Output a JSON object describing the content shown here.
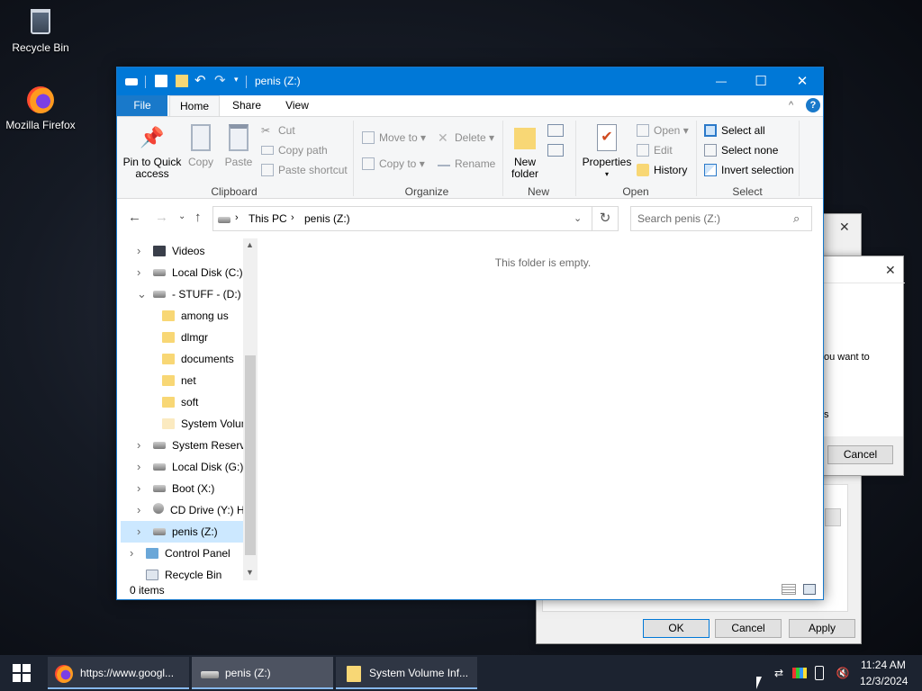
{
  "desktop": {
    "recycle_bin": "Recycle Bin",
    "firefox": "Mozilla Firefox"
  },
  "bg_dialogs": {
    "partial_text_1": "ou want to",
    "partial_text_2": "s",
    "cancel_inner": "Cancel",
    "ok": "OK",
    "cancel": "Cancel",
    "apply": "Apply",
    "close": "✕"
  },
  "window": {
    "title": "penis (Z:)",
    "minimize": "—",
    "maximize": "☐",
    "close": "✕",
    "tabs": {
      "file": "File",
      "home": "Home",
      "share": "Share",
      "view": "View"
    },
    "help": "?",
    "collapse": "^",
    "ribbon": {
      "clipboard": {
        "label": "Clipboard",
        "pin": "Pin to Quick access",
        "copy": "Copy",
        "paste": "Paste",
        "cut": "Cut",
        "copy_path": "Copy path",
        "paste_shortcut": "Paste shortcut"
      },
      "organize": {
        "label": "Organize",
        "move_to": "Move to",
        "copy_to": "Copy to",
        "delete": "Delete",
        "rename": "Rename"
      },
      "new": {
        "label": "New",
        "new_folder": "New folder"
      },
      "open": {
        "label": "Open",
        "properties": "Properties",
        "open": "Open",
        "edit": "Edit",
        "history": "History"
      },
      "select": {
        "label": "Select",
        "select_all": "Select all",
        "select_none": "Select none",
        "invert": "Invert selection"
      }
    },
    "address": {
      "crumbs": [
        "This PC",
        "penis (Z:)"
      ],
      "search_placeholder": "Search penis (Z:)"
    },
    "nav": [
      {
        "label": "Videos",
        "type": "videos"
      },
      {
        "label": "Local Disk (C:)",
        "type": "drive"
      },
      {
        "label": "- STUFF - (D:)",
        "type": "drive"
      },
      {
        "label": "among us",
        "type": "folder"
      },
      {
        "label": "dlmgr",
        "type": "folder"
      },
      {
        "label": "documents",
        "type": "folder"
      },
      {
        "label": "net",
        "type": "folder"
      },
      {
        "label": "soft",
        "type": "folder"
      },
      {
        "label": "System Volume Information",
        "type": "sysfolder"
      },
      {
        "label": "System Reserved",
        "type": "drive"
      },
      {
        "label": "Local Disk (G:)",
        "type": "drive"
      },
      {
        "label": "Boot (X:)",
        "type": "drive"
      },
      {
        "label": "CD Drive (Y:) H",
        "type": "cd"
      },
      {
        "label": "penis (Z:)",
        "type": "drive"
      },
      {
        "label": "Control Panel",
        "type": "cpanel"
      },
      {
        "label": "Recycle Bin",
        "type": "recycle"
      }
    ],
    "empty_message": "This folder is empty.",
    "status": "0 items"
  },
  "taskbar": {
    "items": [
      "https://www.googl...",
      "penis (Z:)",
      "System Volume Inf..."
    ],
    "time": "11:24 AM",
    "date": "12/3/2024"
  }
}
